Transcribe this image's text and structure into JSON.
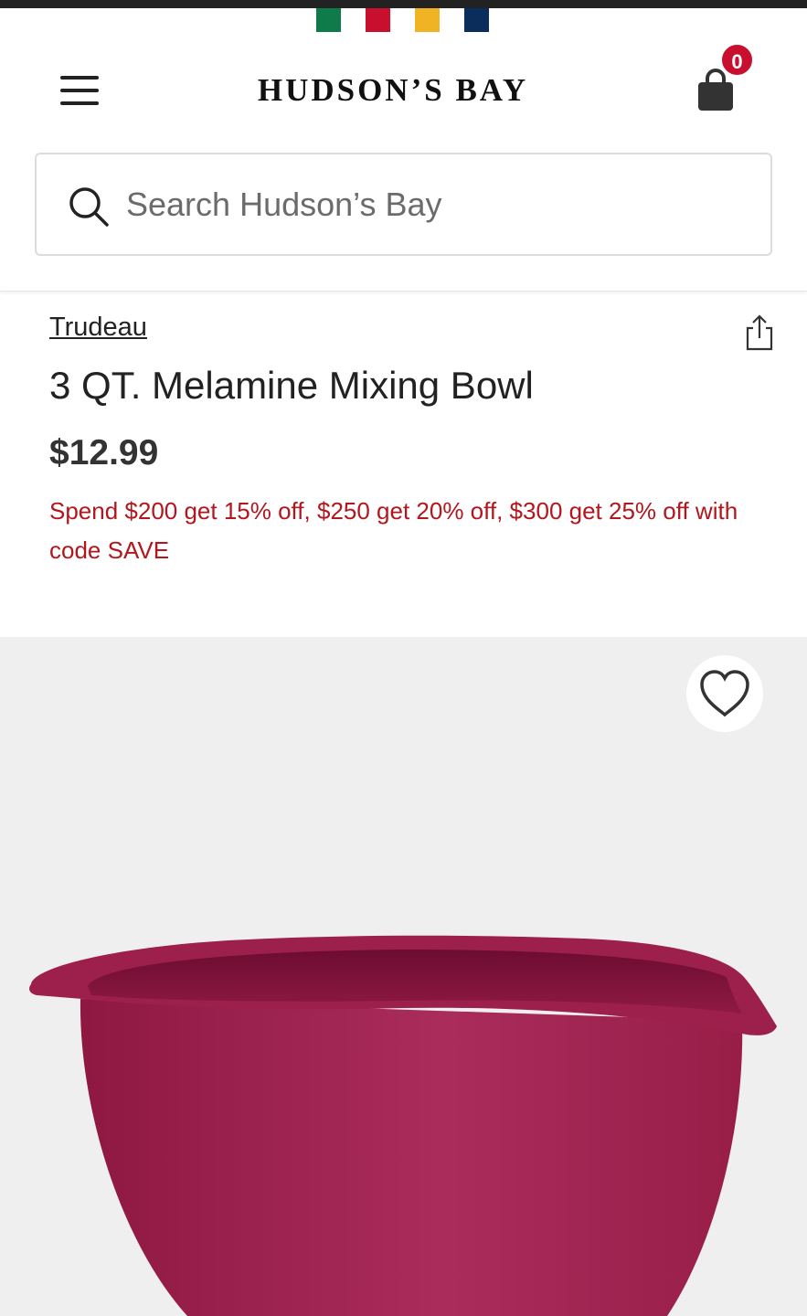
{
  "brand_colors": {
    "stripes": [
      "#0f7b4b",
      "#c8102e",
      "#f0b323",
      "#0a2d5c"
    ],
    "promo": "#b3161c",
    "badge": "#c8102e",
    "product": "#a3214f"
  },
  "header": {
    "logo": "HUDSON’S BAY",
    "bag_count": "0",
    "menu_icon": "hamburger-menu-icon",
    "bag_icon": "shopping-bag-icon"
  },
  "search": {
    "placeholder": "Search Hudson’s Bay",
    "value": "",
    "icon": "search-icon"
  },
  "product": {
    "brand": "Trudeau",
    "title": "3 QT. Melamine Mixing Bowl",
    "price": "$12.99",
    "promo": "Spend $200 get 15% off, $250 get 20% off, $300 get 25% off with code SAVE",
    "share_icon": "share-icon",
    "favorite_icon": "heart-icon"
  }
}
